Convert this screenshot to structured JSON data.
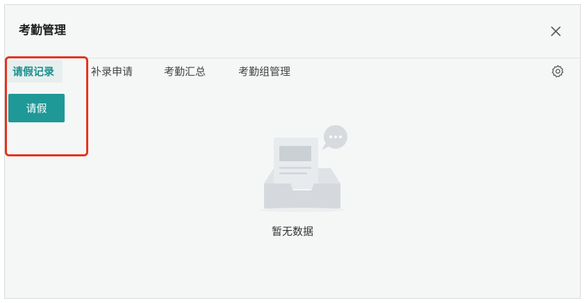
{
  "dialog": {
    "title": "考勤管理",
    "close_icon": "close-icon",
    "settings_icon": "settings-gear-icon"
  },
  "tabs": [
    {
      "label": "请假记录",
      "active": true
    },
    {
      "label": "补录申请",
      "active": false
    },
    {
      "label": "考勤汇总",
      "active": false
    },
    {
      "label": "考勤组管理",
      "active": false
    }
  ],
  "actions": {
    "leave_button_label": "请假"
  },
  "empty_state": {
    "text": "暂无数据",
    "icon": "empty-inbox-icon"
  },
  "colors": {
    "accent": "#1f9898",
    "active_tab_bg": "#e6efee",
    "highlight_border": "#e5321f",
    "dialog_bg": "#f5f7f6"
  }
}
